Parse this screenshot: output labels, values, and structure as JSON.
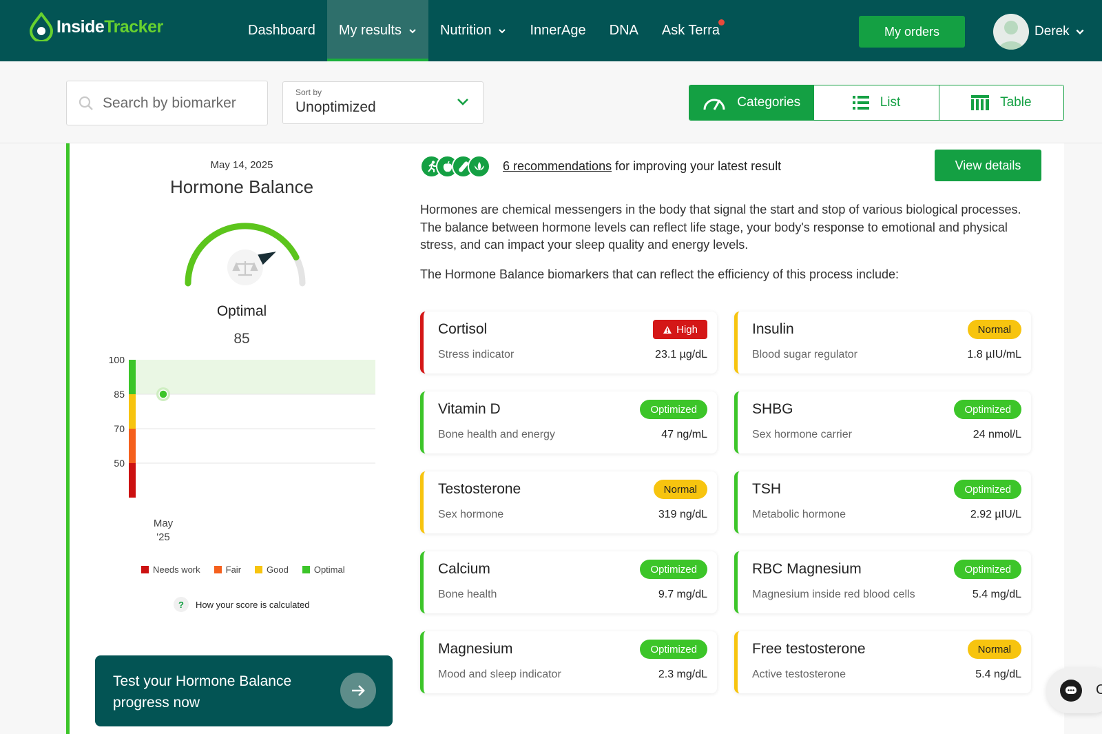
{
  "app": {
    "logo_inside": "Inside",
    "logo_tracker": "Tracker"
  },
  "nav": {
    "links": [
      {
        "label": "Dashboard"
      },
      {
        "label": "My results"
      },
      {
        "label": "Nutrition"
      },
      {
        "label": "InnerAge"
      },
      {
        "label": "DNA"
      },
      {
        "label": "Ask Terra"
      }
    ],
    "orders_label": "My orders",
    "user_name": "Derek"
  },
  "toolbar": {
    "search_placeholder": "Search by biomarker",
    "sort_label": "Sort by",
    "sort_value": "Unoptimized",
    "views": [
      {
        "label": "Categories",
        "active": true
      },
      {
        "label": "List",
        "active": false
      },
      {
        "label": "Table",
        "active": false
      }
    ]
  },
  "left": {
    "date": "May 14, 2025",
    "title": "Hormone Balance",
    "gauge_value": 85,
    "status": "Optimal",
    "score": "85",
    "legend": [
      {
        "label": "Needs work",
        "color": "#cc1111"
      },
      {
        "label": "Fair",
        "color": "#f5601d"
      },
      {
        "label": "Good",
        "color": "#f7c40f"
      },
      {
        "label": "Optimal",
        "color": "#3cc529"
      }
    ],
    "how_calculated": "How your score is calculated",
    "cta_text": "Test your Hormone Balance progress now"
  },
  "chart_data": {
    "type": "scatter",
    "yticks": [
      "100",
      "85",
      "70",
      "50"
    ],
    "ylim": [
      40,
      100
    ],
    "x_label_line1": "May",
    "x_label_line2": "'25",
    "points": [
      {
        "x": "May '25",
        "y": 85
      }
    ],
    "bands": [
      {
        "label": "Needs work",
        "from": 40,
        "to": 50,
        "color": "#cc1111"
      },
      {
        "label": "Fair",
        "from": 50,
        "to": 70,
        "color": "#f5601d"
      },
      {
        "label": "Good",
        "from": 70,
        "to": 85,
        "color": "#f7c40f"
      },
      {
        "label": "Optimal",
        "from": 85,
        "to": 100,
        "color": "#3cc529"
      }
    ]
  },
  "right": {
    "recs_link": "6 recommendations",
    "recs_text": " for improving your latest result",
    "view_details": "View details",
    "description": "Hormones are chemical messengers in the body that signal the start and stop of various biological processes. The balance between hormone levels can reflect life stage, your body's response to emotional and physical stress, and can impact your sleep quality and energy levels.",
    "description2": "The Hormone Balance biomarkers that can reflect the efficiency of this process include:",
    "biomarkers": [
      {
        "name": "Cortisol",
        "sub": "Stress indicator",
        "value": "23.1 µg/dL",
        "status": "High",
        "kind": "high"
      },
      {
        "name": "Insulin",
        "sub": "Blood sugar regulator",
        "value": "1.8 µIU/mL",
        "status": "Normal",
        "kind": "normal"
      },
      {
        "name": "Vitamin D",
        "sub": "Bone health and energy",
        "value": "47 ng/mL",
        "status": "Optimized",
        "kind": "optimized"
      },
      {
        "name": "SHBG",
        "sub": "Sex hormone carrier",
        "value": "24 nmol/L",
        "status": "Optimized",
        "kind": "optimized"
      },
      {
        "name": "Testosterone",
        "sub": "Sex hormone",
        "value": "319 ng/dL",
        "status": "Normal",
        "kind": "normal"
      },
      {
        "name": "TSH",
        "sub": "Metabolic hormone",
        "value": "2.92 µIU/L",
        "status": "Optimized",
        "kind": "optimized"
      },
      {
        "name": "Calcium",
        "sub": "Bone health",
        "value": "9.7 mg/dL",
        "status": "Optimized",
        "kind": "optimized"
      },
      {
        "name": "RBC Magnesium",
        "sub": "Magnesium inside red blood cells",
        "value": "5.4 mg/dL",
        "status": "Optimized",
        "kind": "optimized"
      },
      {
        "name": "Magnesium",
        "sub": "Mood and sleep indicator",
        "value": "2.3 mg/dL",
        "status": "Optimized",
        "kind": "optimized"
      },
      {
        "name": "Free testosterone",
        "sub": "Active testosterone",
        "value": "5.4 ng/dL",
        "status": "Normal",
        "kind": "normal"
      }
    ]
  },
  "chat": {
    "label": "C"
  },
  "colors": {
    "brand_dark": "#035454",
    "brand_green": "#14a043",
    "optimal": "#3cc529",
    "normal": "#f7c40f",
    "high": "#d41717"
  }
}
